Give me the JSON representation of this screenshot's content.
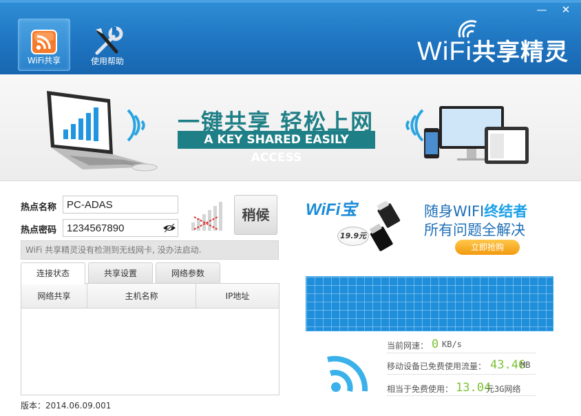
{
  "window": {
    "minimize_glyph": "—",
    "close_glyph": "✕"
  },
  "nav": {
    "tabs": [
      {
        "label": "WiFi共享",
        "icon": "wifi-share-icon",
        "active": true
      },
      {
        "label": "使用帮助",
        "icon": "tools-icon",
        "active": false
      }
    ]
  },
  "logo": {
    "latin": "WiFi",
    "cn": "共享精灵"
  },
  "banner": {
    "title": "一键共享 轻松上网",
    "subtitle": "A KEY SHARED EASILY ACCESS"
  },
  "form": {
    "ssid_label": "热点名称",
    "ssid_value": "PC-ADAS",
    "password_label": "热点密码",
    "password_value": "1234567890",
    "wait_button": "稍候",
    "status_message": "WiFi 共享精灵没有检测到无线网卡, 没办法启动."
  },
  "tabs": [
    {
      "label": "连接状态",
      "active": true
    },
    {
      "label": "共享设置",
      "active": false
    },
    {
      "label": "网络参数",
      "active": false
    }
  ],
  "table": {
    "columns": [
      "网络共享",
      "主机名称",
      "IP地址"
    ],
    "rows": []
  },
  "version": "版本：2014.06.09.001",
  "ad": {
    "brand": "WiFi宝",
    "price": "19.9元",
    "line1_prefix": "随身WIFI",
    "line1_highlight": "终结者",
    "line2": "所有问题全解决",
    "button": "立即抢购"
  },
  "stats": {
    "speed_label": "当前网速：",
    "speed_value": "0",
    "speed_unit": "KB/s",
    "traffic_label": "移动设备已免费使用流量：",
    "traffic_value": "43.46",
    "traffic_unit": "MB",
    "saved_label": "相当于免费使用：",
    "saved_value": "13.04",
    "saved_unit": "元3G网络"
  },
  "colors": {
    "titlebar": "#1f75c1",
    "banner_accent": "#1f7f86",
    "stat_value": "#7cc234",
    "ad_button": "#f29a10"
  }
}
